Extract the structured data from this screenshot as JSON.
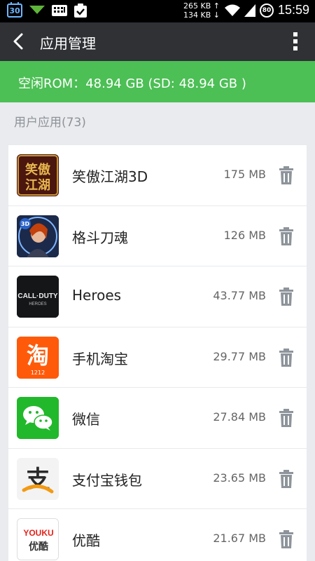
{
  "statusbar": {
    "calendar_day": "30",
    "net_up": "265 KB ↑",
    "net_down": "134 KB ↓",
    "battery": "80",
    "time": "15:59"
  },
  "appbar": {
    "title": "应用管理",
    "back_icon": "back-chevron-icon",
    "menu_icon": "overflow-menu-icon"
  },
  "storage": {
    "rom_text": "空闲ROM：48.94 GB (SD: 48.94 GB )"
  },
  "section": {
    "title": "用户应用(73)"
  },
  "apps": [
    {
      "name": "笑傲江湖3D",
      "size": "175 MB",
      "icon": "xiaoaojianghu-icon"
    },
    {
      "name": "格斗刀魂",
      "size": "126 MB",
      "icon": "gedoudaohun-icon"
    },
    {
      "name": "Heroes",
      "size": "43.77 MB",
      "icon": "callofduty-heroes-icon"
    },
    {
      "name": "手机淘宝",
      "size": "29.77 MB",
      "icon": "taobao-icon"
    },
    {
      "name": "微信",
      "size": "27.84 MB",
      "icon": "wechat-icon"
    },
    {
      "name": "支付宝钱包",
      "size": "23.65 MB",
      "icon": "alipay-icon"
    },
    {
      "name": "优酷",
      "size": "21.67 MB",
      "icon": "youku-icon"
    }
  ],
  "icon_text": {
    "xiao_line1": "笑傲",
    "xiao_line2": "江湖",
    "gedou_badge": "3D",
    "heroes_line1": "CALL·DUTY",
    "heroes_line2": "HEROES",
    "taobao_char": "淘",
    "taobao_sub": "1212",
    "alipay_char": "支",
    "youku_logo": "YOUKU",
    "youku_cn": "优酷"
  },
  "colors": {
    "accent_green": "#4cbf55",
    "appbar": "#2f3135",
    "trash": "#8e949b"
  }
}
